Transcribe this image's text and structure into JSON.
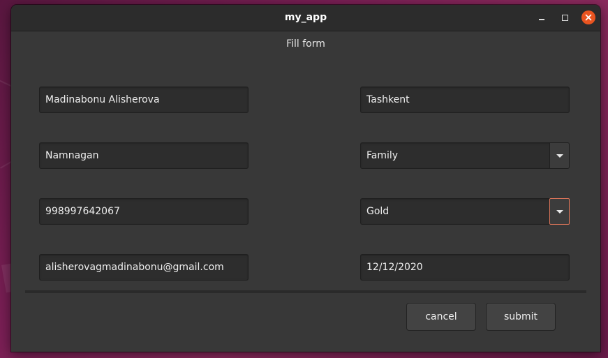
{
  "window": {
    "title": "my_app",
    "subtitle": "Fill form"
  },
  "titlebar_buttons": {
    "minimize_icon": "minimize-icon",
    "maximize_icon": "maximize-icon",
    "close_icon": "close-icon",
    "close_color": "#e95420"
  },
  "form": {
    "name": "Madinabonu Alisherova",
    "city": "Tashkent",
    "region": "Namnagan",
    "relation": "Family",
    "phone": "998997642067",
    "level": "Gold",
    "email": "alisherovagmadinabonu@gmail.com",
    "date": "12/12/2020"
  },
  "buttons": {
    "cancel": "cancel",
    "submit": "submit"
  },
  "colors": {
    "focus_accent": "#e0765a",
    "window_bg": "#383838",
    "titlebar_bg": "#2c2c2c"
  }
}
